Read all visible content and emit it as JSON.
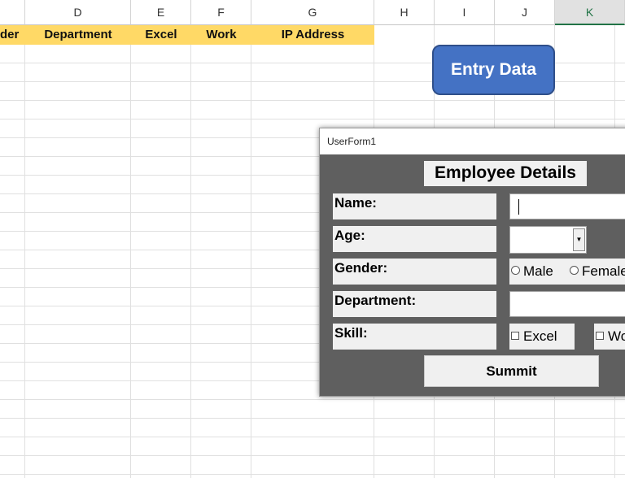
{
  "sheet": {
    "columns": [
      {
        "label": ""
      },
      {
        "label": "D"
      },
      {
        "label": "E"
      },
      {
        "label": "F"
      },
      {
        "label": "G"
      },
      {
        "label": "H"
      },
      {
        "label": "I"
      },
      {
        "label": "J"
      },
      {
        "label": "K"
      }
    ],
    "headers": [
      "der",
      "Department",
      "Excel",
      "Work",
      "IP Address"
    ],
    "header_fill": "#ffd966",
    "selected_column": "K"
  },
  "entry_button": {
    "label": "Entry Data",
    "color": "#4472c4"
  },
  "userform": {
    "window_title": "UserForm1",
    "title": "Employee Details",
    "labels": {
      "name": "Name:",
      "age": "Age:",
      "gender": "Gender:",
      "department": "Department:",
      "skill": "Skill:"
    },
    "inputs": {
      "name_value": "",
      "age_value": "",
      "department_value": ""
    },
    "gender_options": [
      "Male",
      "Female"
    ],
    "skill_options": [
      "Excel",
      "Wo"
    ],
    "submit_label": "Summit",
    "body_color": "#5f5f5f"
  }
}
